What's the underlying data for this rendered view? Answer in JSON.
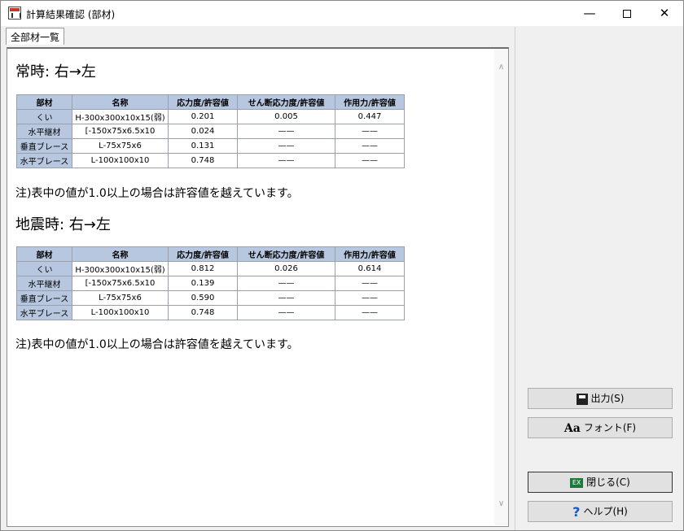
{
  "window": {
    "title": "計算結果確認 (部材)",
    "minimize": "—",
    "close": "✕"
  },
  "tabs": [
    {
      "label": "全部材一覧"
    }
  ],
  "columns": [
    "部材",
    "名称",
    "応力度/許容値",
    "せん断応力度/許容値",
    "作用力/許容値"
  ],
  "sections": [
    {
      "title": "常時:  右→左",
      "rows": [
        [
          "くい",
          "H-300x300x10x15(弱)",
          "0.201",
          "0.005",
          "0.447"
        ],
        [
          "水平継材",
          "[-150x75x6.5x10",
          "0.024",
          "——",
          "——"
        ],
        [
          "垂直ブレース",
          "L-75x75x6",
          "0.131",
          "——",
          "——"
        ],
        [
          "水平ブレース",
          "L-100x100x10",
          "0.748",
          "——",
          "——"
        ]
      ],
      "note": "注)表中の値が1.0以上の場合は許容値を越えています。"
    },
    {
      "title": "地震時:  右→左",
      "rows": [
        [
          "くい",
          "H-300x300x10x15(弱)",
          "0.812",
          "0.026",
          "0.614"
        ],
        [
          "水平継材",
          "[-150x75x6.5x10",
          "0.139",
          "——",
          "——"
        ],
        [
          "垂直ブレース",
          "L-75x75x6",
          "0.590",
          "——",
          "——"
        ],
        [
          "水平ブレース",
          "L-100x100x10",
          "0.748",
          "——",
          "——"
        ]
      ],
      "note": "注)表中の値が1.0以上の場合は許容値を越えています。"
    }
  ],
  "buttons": {
    "output": "出力(S)",
    "font": "フォント(F)",
    "close": "閉じる(C)",
    "help": "ヘルプ(H)"
  },
  "icons": {
    "exit_icon_text": "EX"
  },
  "colors": {
    "table_header_bg": "#b8c7e0",
    "exit_icon": "#1a7a3a",
    "help_icon": "#1a56c4"
  }
}
